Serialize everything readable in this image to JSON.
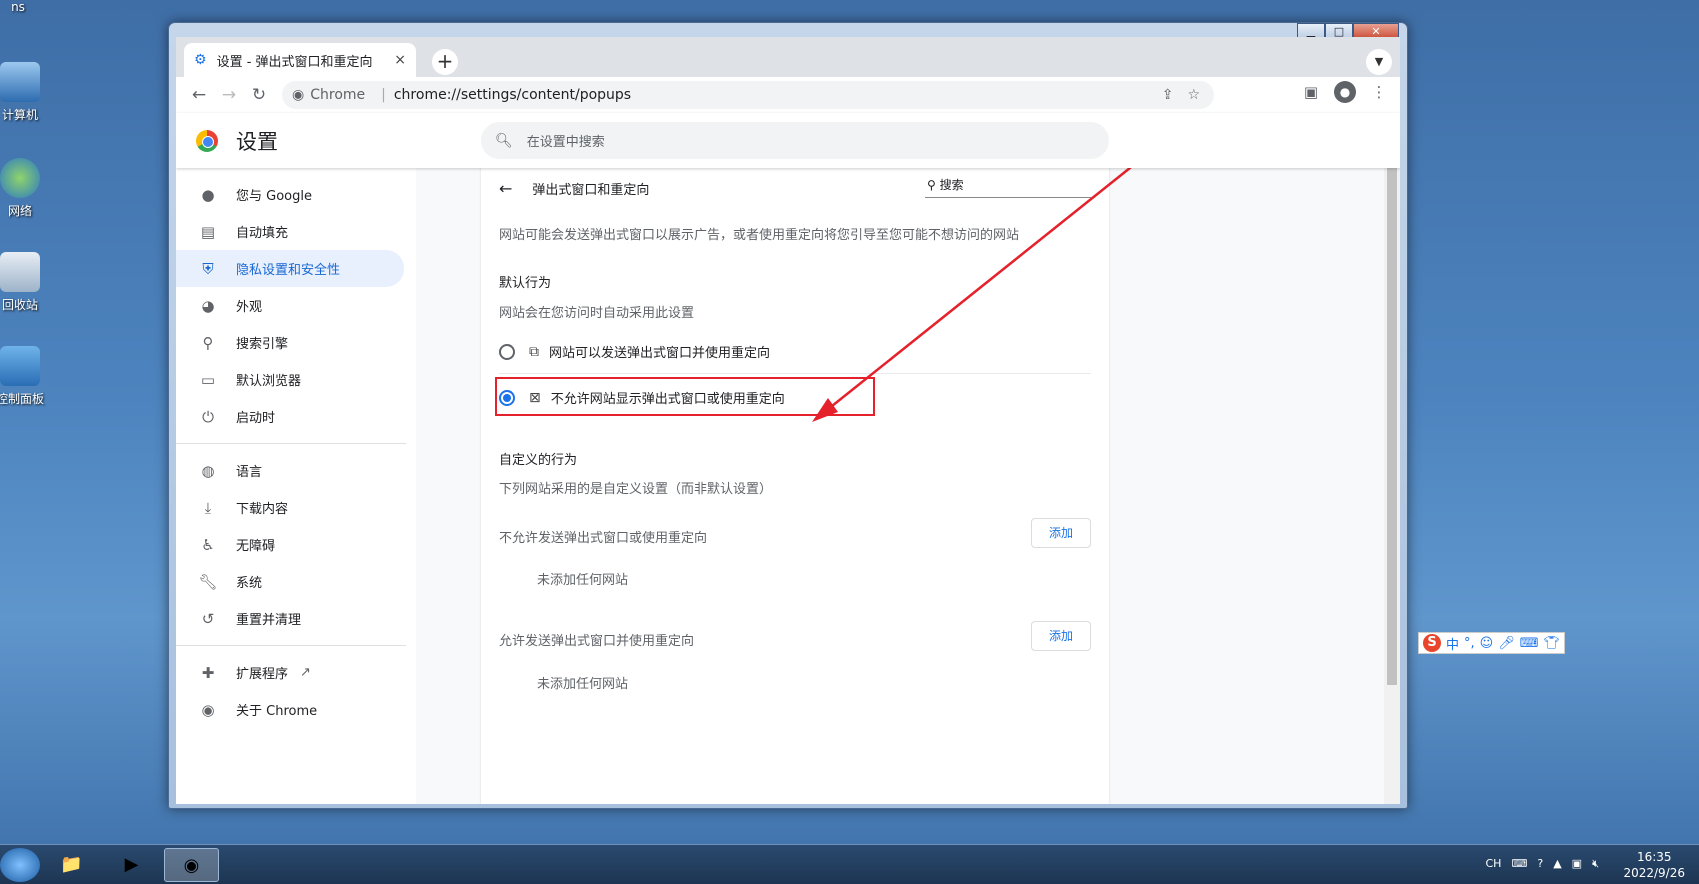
{
  "desktop": {
    "icons": [
      "ns",
      "计算机",
      "网络",
      "回收站",
      "控制面板"
    ]
  },
  "window": {
    "min": "▁",
    "max": "□",
    "close": "✕"
  },
  "tab": {
    "title": "设置 - 弹出式窗口和重定向",
    "close": "×",
    "new": "+"
  },
  "toolbar": {
    "site_chip": "Chrome",
    "url": "chrome://settings/content/popups"
  },
  "header": {
    "title": "设置",
    "search_placeholder": "在设置中搜索"
  },
  "sidebar": {
    "items": [
      {
        "icon": "person-icon",
        "glyph": "👤",
        "label": "您与 Google"
      },
      {
        "icon": "clipboard-icon",
        "glyph": "📋",
        "label": "自动填充"
      },
      {
        "icon": "shield-icon",
        "glyph": "🛡",
        "label": "隐私设置和安全性",
        "active": true
      },
      {
        "icon": "palette-icon",
        "glyph": "🎨",
        "label": "外观"
      },
      {
        "icon": "search-icon",
        "glyph": "🔍",
        "label": "搜索引擎"
      },
      {
        "icon": "browser-icon",
        "glyph": "▭",
        "label": "默认浏览器"
      },
      {
        "icon": "power-icon",
        "glyph": "⏻",
        "label": "启动时"
      },
      {
        "icon": "globe-icon",
        "glyph": "🌐",
        "label": "语言"
      },
      {
        "icon": "download-icon",
        "glyph": "⬇",
        "label": "下载内容"
      },
      {
        "icon": "accessibility-icon",
        "glyph": "🚶",
        "label": "无障碍"
      },
      {
        "icon": "wrench-icon",
        "glyph": "🔧",
        "label": "系统"
      },
      {
        "icon": "history-icon",
        "glyph": "↺",
        "label": "重置并清理"
      },
      {
        "icon": "puzzle-icon",
        "glyph": "🧩",
        "label": "扩展程序"
      },
      {
        "icon": "chrome-icon",
        "glyph": "◉",
        "label": "关于 Chrome"
      }
    ]
  },
  "main": {
    "page_title": "弹出式窗口和重定向",
    "search_placeholder": "搜索",
    "description": "网站可能会发送弹出式窗口以展示广告，或者使用重定向将您引导至您可能不想访问的网站",
    "default_heading": "默认行为",
    "default_sub": "网站会在您访问时自动采用此设置",
    "option_allow": "网站可以发送弹出式窗口并使用重定向",
    "option_block": "不允许网站显示弹出式窗口或使用重定向",
    "selected": "block",
    "custom_heading": "自定义的行为",
    "custom_sub": "下列网站采用的是自定义设置（而非默认设置）",
    "block_list_title": "不允许发送弹出式窗口或使用重定向",
    "block_empty": "未添加任何网站",
    "allow_list_title": "允许发送弹出式窗口并使用重定向",
    "allow_empty": "未添加任何网站",
    "add_label": "添加"
  },
  "taskbar": {
    "lang": "CH",
    "time": "16:35",
    "date": "2022/9/26"
  },
  "ime": {
    "logo": "S",
    "label": "中"
  },
  "colors": {
    "accent": "#1a73e8",
    "highlight": "#e5212b",
    "active_bg": "#e8f0fe"
  }
}
